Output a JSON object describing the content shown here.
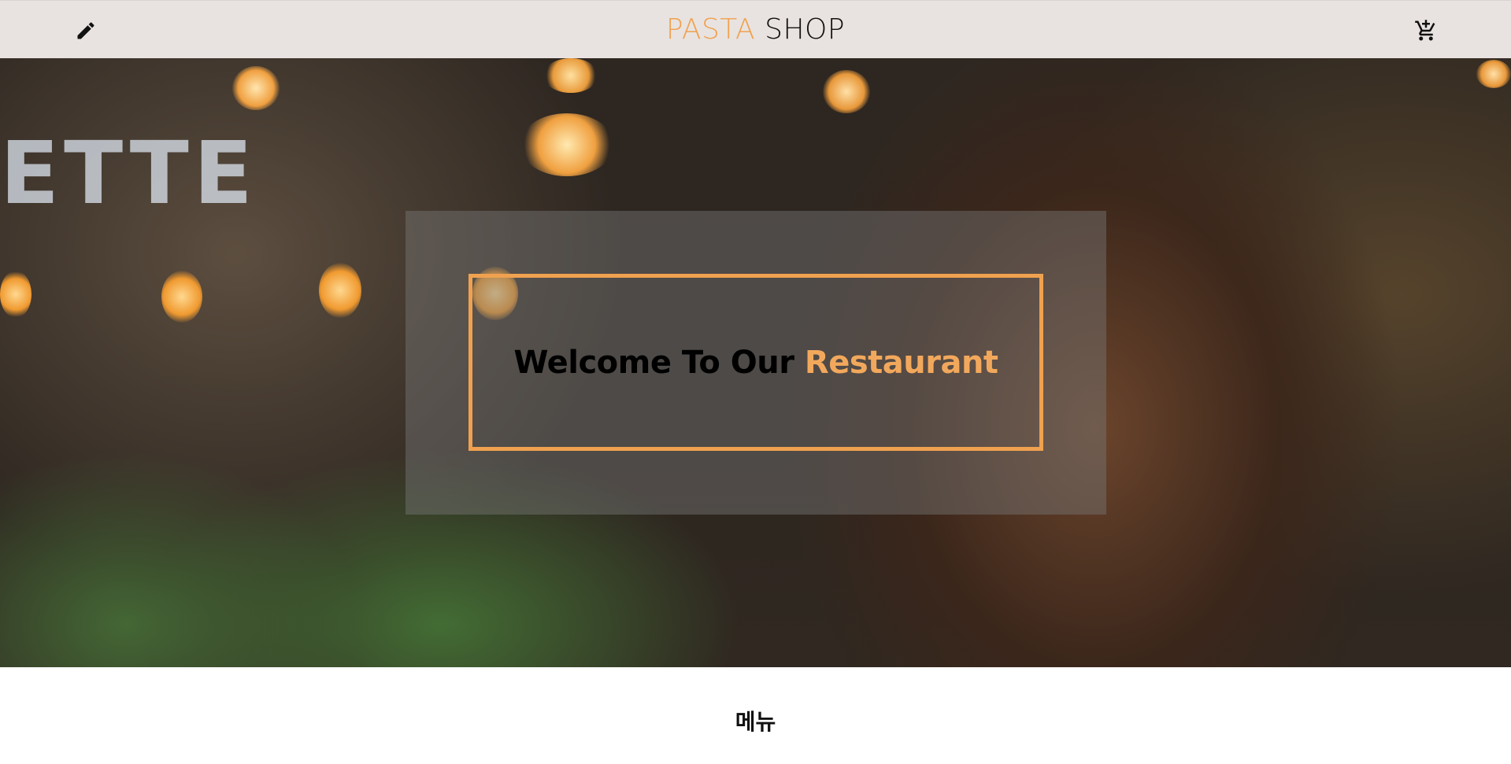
{
  "header": {
    "logo_accent": "PASTA",
    "logo_rest": "SHOP",
    "edit_icon": "pencil-icon",
    "cart_icon": "cart-plus-icon"
  },
  "hero": {
    "welcome_text": "Welcome To Our",
    "welcome_accent": "Restaurant",
    "accent_color": "#f0a14f"
  },
  "menu": {
    "title": "메뉴"
  }
}
